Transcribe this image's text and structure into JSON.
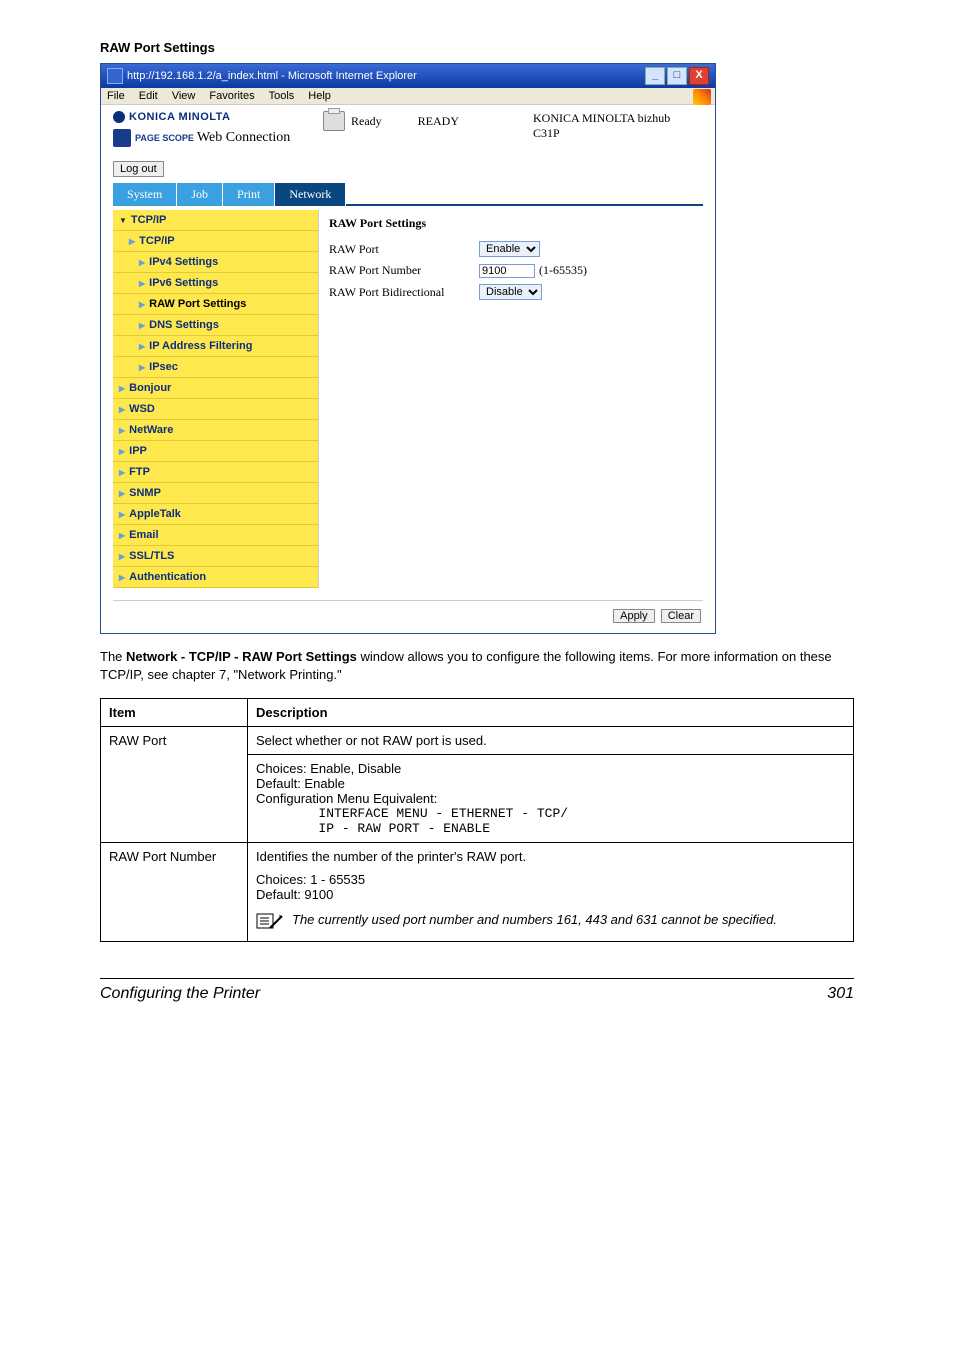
{
  "section_title": "RAW Port Settings",
  "ie": {
    "title": "http://192.168.1.2/a_index.html - Microsoft Internet Explorer",
    "menus": [
      "File",
      "Edit",
      "View",
      "Favorites",
      "Tools",
      "Help"
    ],
    "win_min": "_",
    "win_max": "□",
    "win_close": "X"
  },
  "header": {
    "brand": "KONICA MINOLTA",
    "pagescope_small": "PAGE SCOPE",
    "pagescope_text": "Web Connection",
    "status_label": "Ready",
    "status_value": "READY",
    "model_line1": "KONICA MINOLTA bizhub",
    "model_line2": "C31P",
    "logout": "Log out"
  },
  "tabs": [
    "System",
    "Job",
    "Print",
    "Network"
  ],
  "sidebar": [
    {
      "label": "TCP/IP",
      "level": 0,
      "top": true
    },
    {
      "label": "TCP/IP",
      "level": 1
    },
    {
      "label": "IPv4 Settings",
      "level": 2
    },
    {
      "label": "IPv6 Settings",
      "level": 2
    },
    {
      "label": "RAW Port Settings",
      "level": 2,
      "active": true
    },
    {
      "label": "DNS Settings",
      "level": 2
    },
    {
      "label": "IP Address Filtering",
      "level": 2
    },
    {
      "label": "IPsec",
      "level": 2
    },
    {
      "label": "Bonjour",
      "level": 0
    },
    {
      "label": "WSD",
      "level": 0
    },
    {
      "label": "NetWare",
      "level": 0
    },
    {
      "label": "IPP",
      "level": 0
    },
    {
      "label": "FTP",
      "level": 0
    },
    {
      "label": "SNMP",
      "level": 0
    },
    {
      "label": "AppleTalk",
      "level": 0
    },
    {
      "label": "Email",
      "level": 0
    },
    {
      "label": "SSL/TLS",
      "level": 0
    },
    {
      "label": "Authentication",
      "level": 0
    }
  ],
  "pane": {
    "heading": "RAW Port Settings",
    "row1_label": "RAW Port",
    "row1_value": "Enable",
    "row2_label": "RAW Port Number",
    "row2_value": "9100",
    "row2_range": "(1-65535)",
    "row3_label": "RAW Port Bidirectional",
    "row3_value": "Disable",
    "apply": "Apply",
    "clear": "Clear"
  },
  "para_pre": "The ",
  "para_bold": "Network - TCP/IP - RAW Port Settings",
  "para_post": " window allows you to configure the following items. For more information on these TCP/IP, see chapter 7, \"Network Printing.\"",
  "table": {
    "h1": "Item",
    "h2": "Description",
    "r1_item": "RAW Port",
    "r1_line1": "Select whether or not RAW port is used.",
    "r1_line2": "Choices: Enable, Disable",
    "r1_line3": "Default:  Enable",
    "r1_line4": "Configuration Menu Equivalent:",
    "r1_mono1": "        INTERFACE MENU - ETHERNET - TCP/",
    "r1_mono2": "        IP - RAW PORT - ENABLE",
    "r2_item": "RAW Port Number",
    "r2_line1": "Identifies the number of the printer's RAW port.",
    "r2_line2": "Choices: 1 - 65535",
    "r2_line3": "Default:  9100",
    "r2_note": "The currently used port number and numbers 161, 443 and 631 cannot be specified."
  },
  "footer": {
    "left": "Configuring the Printer",
    "right": "301"
  }
}
